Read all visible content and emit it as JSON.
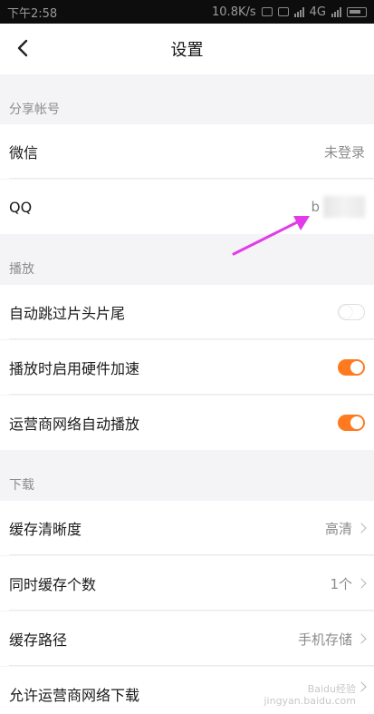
{
  "status_bar": {
    "time": "下午2:58",
    "network_speed": "10.8K/s",
    "signal_label": "4G"
  },
  "nav": {
    "title": "设置"
  },
  "sections": {
    "share": {
      "title": "分享帐号"
    },
    "play": {
      "title": "播放"
    },
    "download": {
      "title": "下载"
    }
  },
  "share_rows": {
    "wechat": {
      "label": "微信",
      "value": "未登录"
    },
    "qq": {
      "label": "QQ",
      "value": "b"
    }
  },
  "play_rows": {
    "skip": {
      "label": "自动跳过片头片尾",
      "on": false
    },
    "hardware": {
      "label": "播放时启用硬件加速",
      "on": true
    },
    "carrier_play": {
      "label": "运营商网络自动播放",
      "on": true
    }
  },
  "download_rows": {
    "clarity": {
      "label": "缓存清晰度",
      "value": "高清"
    },
    "count": {
      "label": "同时缓存个数",
      "value": "1个"
    },
    "path": {
      "label": "缓存路径",
      "value": "手机存储"
    },
    "carrier_download": {
      "label": "允许运营商网络下载",
      "value": ""
    }
  },
  "watermark": {
    "line1": "Baidu经验",
    "line2": "jingyan.baidu.com"
  },
  "colors": {
    "accent": "#ff7a1f",
    "annotation_arrow": "#e23ce8"
  }
}
